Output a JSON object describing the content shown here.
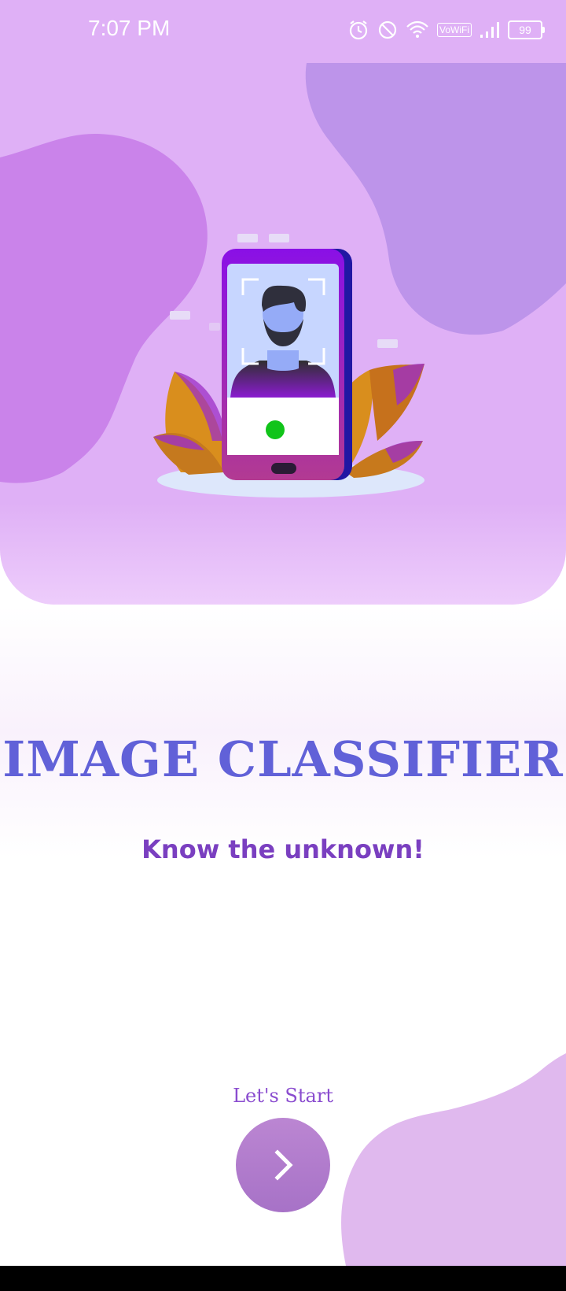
{
  "status_bar": {
    "time": "7:07 PM",
    "icons": [
      "alarm-icon",
      "do-not-disturb-icon",
      "wifi-icon",
      "vowifi-icon",
      "signal-icon",
      "battery-icon"
    ],
    "vowifi_label": "VoWiFi",
    "battery_level": "99"
  },
  "hero": {
    "illustration": "phone-face-scan-illustration"
  },
  "main": {
    "title": "IMAGE CLASSIFIER",
    "tagline": "Know the unknown!"
  },
  "start": {
    "label": "Let's Start",
    "button_icon": "chevron-right-icon"
  },
  "colors": {
    "hero_background": "#dfb0f6",
    "title": "#6161d8",
    "tagline": "#7a3fc0",
    "button": "#b07bcc"
  }
}
